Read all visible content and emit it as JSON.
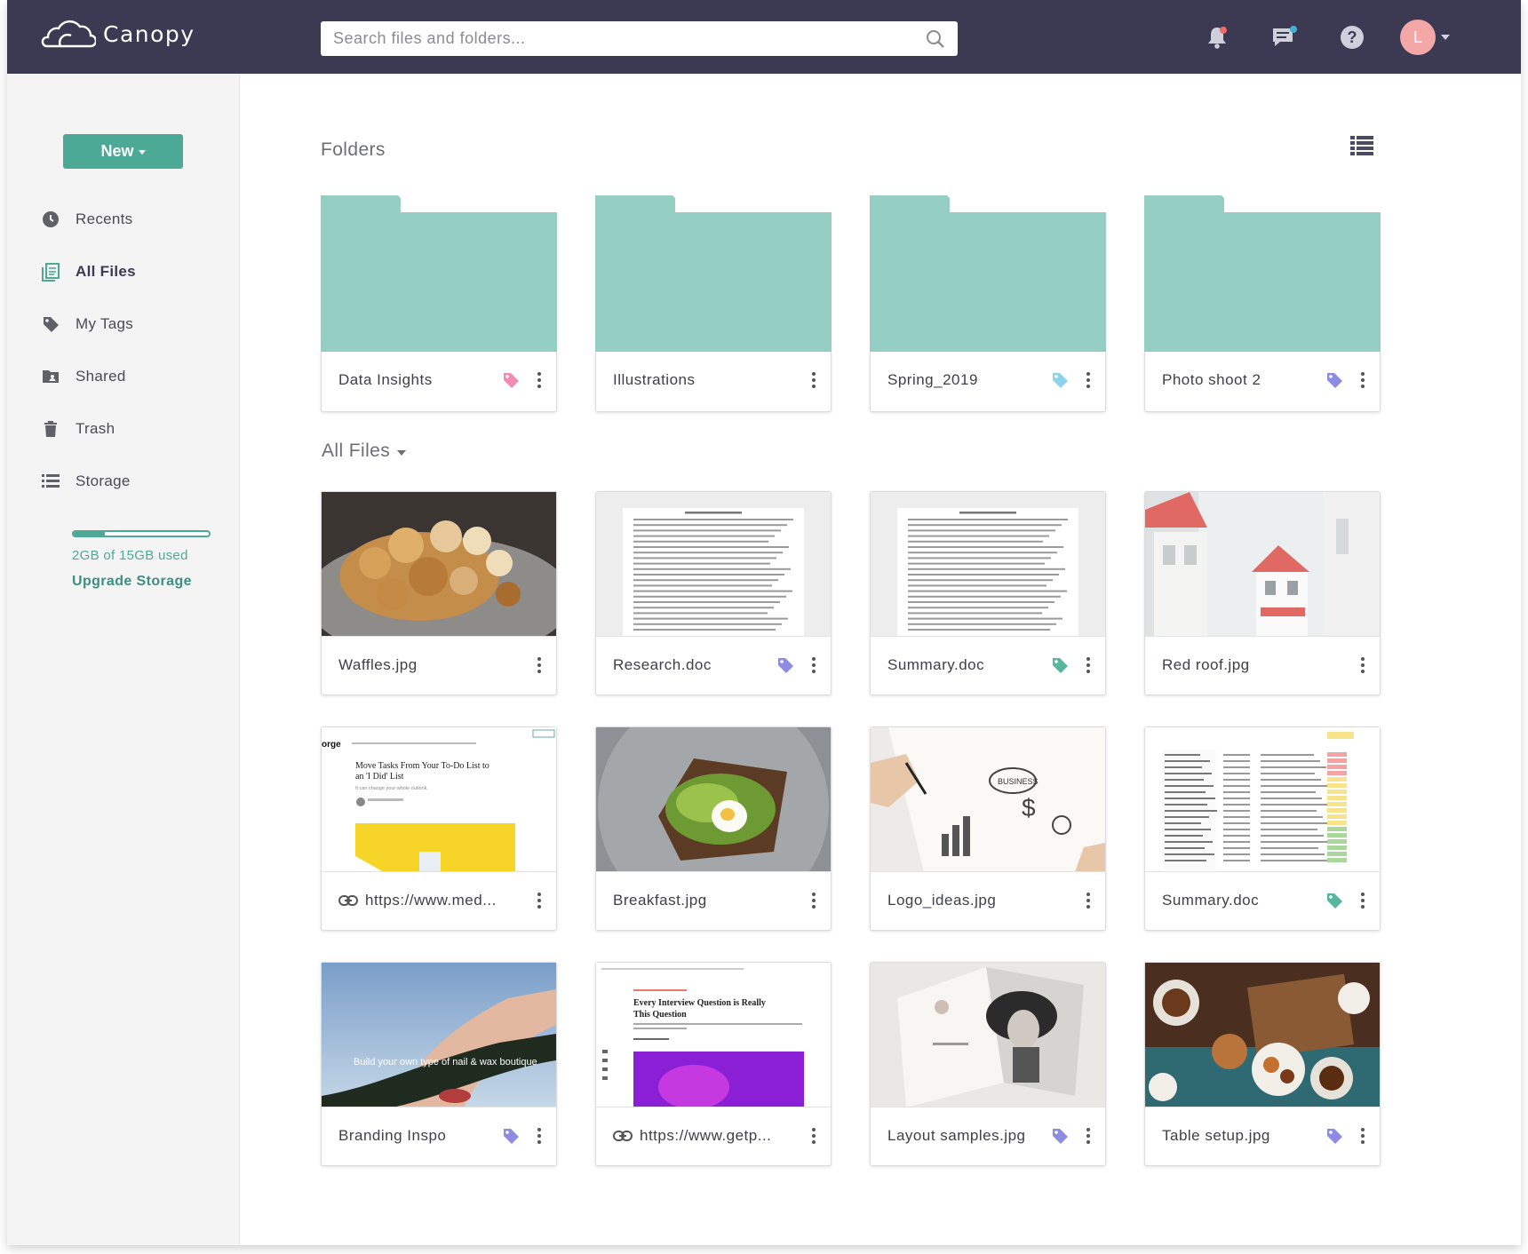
{
  "app": {
    "name": "Canopy"
  },
  "search": {
    "placeholder": "Search files and folders..."
  },
  "user": {
    "initial": "L"
  },
  "colors": {
    "topbar": "#3b3a52",
    "accent": "#4ba996",
    "folder": "#95cfc4",
    "tag_pink": "#f08db4",
    "tag_blue": "#8fd3ea",
    "tag_purple": "#8e8be3",
    "tag_green": "#58b69f"
  },
  "sidebar": {
    "new_label": "New",
    "items": [
      {
        "label": "Recents",
        "icon": "clock-icon"
      },
      {
        "label": "All Files",
        "icon": "files-icon"
      },
      {
        "label": "My Tags",
        "icon": "tag-icon"
      },
      {
        "label": "Shared",
        "icon": "shared-folder-icon"
      },
      {
        "label": "Trash",
        "icon": "trash-icon"
      },
      {
        "label": "Storage",
        "icon": "storage-icon"
      }
    ],
    "storage_used_fraction": 0.23,
    "storage_text": "2GB of 15GB used",
    "upgrade_label": "Upgrade Storage"
  },
  "main": {
    "folders_title": "Folders",
    "files_title": "All Files",
    "folders": [
      {
        "name": "Data Insights",
        "tag": "pink"
      },
      {
        "name": "Illustrations",
        "tag": ""
      },
      {
        "name": "Spring_2019",
        "tag": "blue"
      },
      {
        "name": "Photo shoot 2",
        "tag": "purple"
      }
    ],
    "files": [
      {
        "name": "Waffles.jpg",
        "tag": "",
        "thumb": "waffles"
      },
      {
        "name": "Research.doc",
        "tag": "purple",
        "thumb": "doc"
      },
      {
        "name": "Summary.doc",
        "tag": "green",
        "thumb": "doc"
      },
      {
        "name": "Red roof.jpg",
        "tag": "",
        "thumb": "house"
      },
      {
        "name": "https://www.med...",
        "tag": "",
        "thumb": "web1",
        "link": true
      },
      {
        "name": "Breakfast.jpg",
        "tag": "",
        "thumb": "breakfast"
      },
      {
        "name": "Logo_ideas.jpg",
        "tag": "",
        "thumb": "sketch"
      },
      {
        "name": "Summary.doc",
        "tag": "green",
        "thumb": "sheet"
      },
      {
        "name": "Branding Inspo",
        "tag": "purple",
        "thumb": "branding"
      },
      {
        "name": "https://www.getp...",
        "tag": "",
        "thumb": "web2",
        "link": true
      },
      {
        "name": "Layout samples.jpg",
        "tag": "purple",
        "thumb": "magazine"
      },
      {
        "name": "Table setup.jpg",
        "tag": "purple",
        "thumb": "table"
      }
    ],
    "web1": {
      "brand": "orge",
      "title": "Move Tasks From Your To-Do List to an 'I Did' List",
      "subtitle": "It can change your whole outlook."
    },
    "web2": {
      "title": "Every Interview Question is Really This Question"
    },
    "branding_text": "Build your own type of nail & wax boutique"
  }
}
